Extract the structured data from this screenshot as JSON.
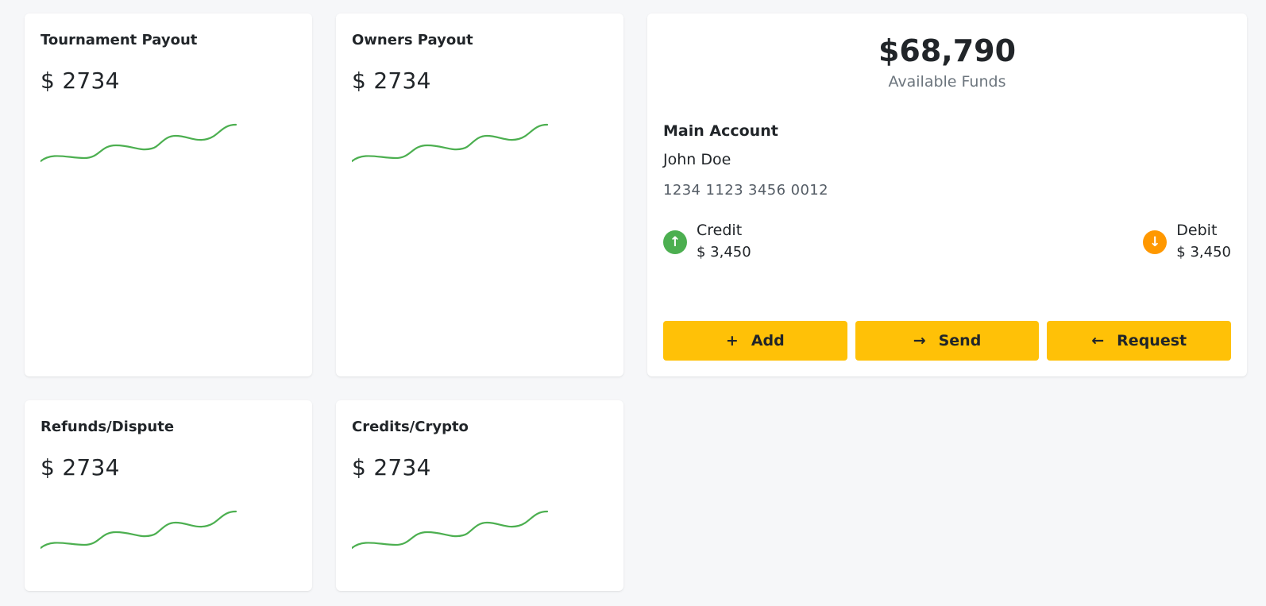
{
  "cards": [
    {
      "title": "Tournament Payout",
      "value": "$ 2734"
    },
    {
      "title": "Owners Payout",
      "value": "$ 2734"
    },
    {
      "title": "Refunds/Dispute",
      "value": "$ 2734"
    },
    {
      "title": "Credits/Crypto",
      "value": "$ 2734"
    }
  ],
  "sparkline_color": "#4caf50",
  "funds": {
    "amount": "$68,790",
    "label": "Available Funds",
    "account_title": "Main Account",
    "account_name": "John Doe",
    "account_number": "1234 1123 3456 0012",
    "credit": {
      "icon": "arrow-up-icon",
      "glyph": "↑",
      "label": "Credit",
      "amount": "$ 3,450",
      "color": "#4caf50"
    },
    "debit": {
      "icon": "arrow-down-icon",
      "glyph": "↓",
      "label": "Debit",
      "amount": "$ 3,450",
      "color": "#ff9800"
    }
  },
  "actions": {
    "add": {
      "glyph": "+",
      "label": "Add",
      "icon": "plus-icon"
    },
    "send": {
      "glyph": "→",
      "label": "Send",
      "icon": "arrow-right-icon"
    },
    "request": {
      "glyph": "←",
      "label": "Request",
      "icon": "arrow-left-icon"
    }
  },
  "accent_color": "#ffc107"
}
